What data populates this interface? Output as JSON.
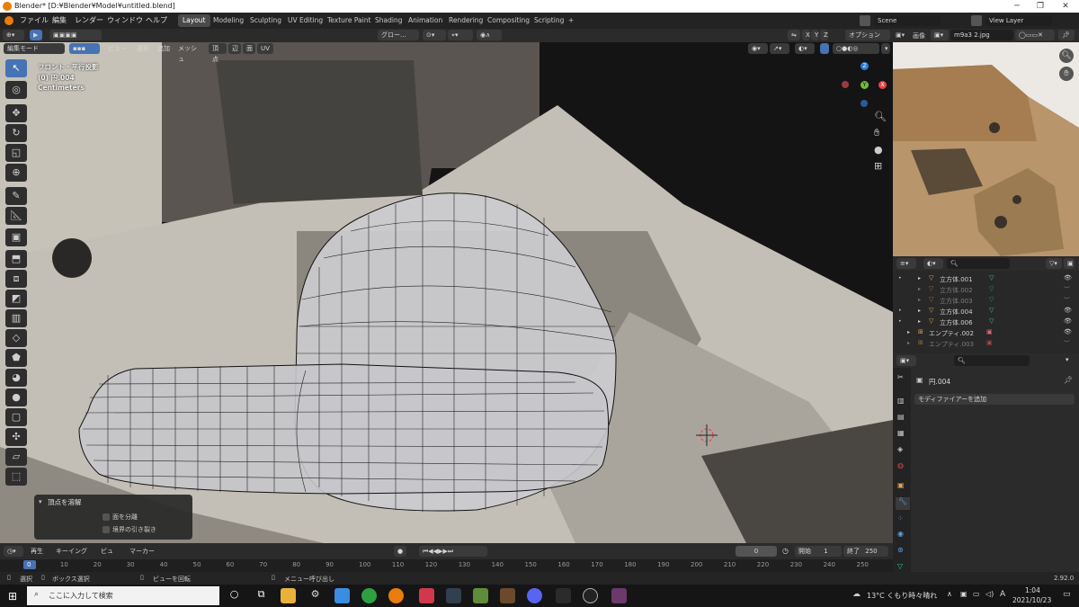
{
  "window": {
    "title": "Blender* [D:¥Blender¥Model¥untitled.blend]",
    "minimize": "─",
    "maximize": "❐",
    "close": "✕"
  },
  "menu": {
    "file": "ファイル",
    "edit": "編集",
    "render": "レンダー",
    "window": "ウィンドウ",
    "help": "ヘルプ"
  },
  "workspaces": [
    "Layout",
    "Modeling",
    "Sculpting",
    "UV Editing",
    "Texture Paint",
    "Shading",
    "Animation",
    "Rendering",
    "Compositing",
    "Scripting",
    "+"
  ],
  "scene": {
    "label": "Scene",
    "view_layer": "View Layer"
  },
  "header": {
    "mode": "編集モード",
    "view": "ビュー",
    "select": "選択",
    "add": "追加",
    "mesh": "メッシュ",
    "vertex": "頂点",
    "edge": "辺",
    "face": "面",
    "uv": "UV",
    "orientation": "グロー...",
    "options": "オプション",
    "axes": [
      "X",
      "Y",
      "Z"
    ]
  },
  "viewport_info": {
    "view_name": "フロント・平行投影",
    "object": "(0) 円.004",
    "units": "Centimeters"
  },
  "gizmo": {
    "x": "X",
    "y": "Y",
    "z": "Z"
  },
  "image_editor": {
    "label": "画像",
    "filename": "m9a3 2.jpg"
  },
  "outliner": {
    "rows": [
      {
        "name": "立方体.001",
        "visible": true
      },
      {
        "name": "立方体.002",
        "visible": false
      },
      {
        "name": "立方体.003",
        "visible": false
      },
      {
        "name": "立方体.004",
        "visible": true
      },
      {
        "name": "立方体.006",
        "visible": true
      },
      {
        "name": "エンプティ.002",
        "visible": true
      },
      {
        "name": "エンプティ.003",
        "visible": false
      }
    ]
  },
  "properties": {
    "object_name": "円.004",
    "add_modifier": "モディファイアーを追加"
  },
  "operator_panel": {
    "title": "頂点を溶解",
    "option1": "面を分離",
    "option2": "境界の引き裂き"
  },
  "timeline": {
    "playback": "再生",
    "keying": "キーイング",
    "view": "ビュー",
    "marker": "マーカー",
    "current_frame": "0",
    "start_label": "開始",
    "start": "1",
    "end_label": "終了",
    "end": "250",
    "ticks": [
      "0",
      "10",
      "20",
      "30",
      "40",
      "50",
      "60",
      "70",
      "80",
      "90",
      "100",
      "110",
      "120",
      "130",
      "140",
      "150",
      "160",
      "170",
      "180",
      "190",
      "200",
      "210",
      "220",
      "230",
      "240",
      "250"
    ]
  },
  "statusbar": {
    "select": "選択",
    "box_select": "ボックス選択",
    "rotate_view": "ビューを回転",
    "call_menu": "メニュー呼び出し",
    "version": "2.92.0"
  },
  "taskbar": {
    "search_placeholder": "ここに入力して検索",
    "weather": "13°C くもり時々晴れ",
    "time": "1:04",
    "date": "2021/10/23",
    "ime": "A"
  },
  "colors": {
    "accent": "#4772b3",
    "header": "#2b2b2b",
    "x_axis": "#e8424c",
    "y_axis": "#6fbe39",
    "z_axis": "#2d7fd6"
  }
}
